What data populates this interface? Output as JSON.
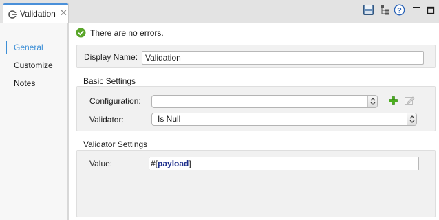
{
  "tab": {
    "label": "Validation",
    "close_glyph": "✕",
    "icon": "connector-icon"
  },
  "toolbar": {
    "icons": [
      "save-icon",
      "tree-icon",
      "help-icon",
      "minimize-icon",
      "maximize-icon"
    ]
  },
  "sidebar": {
    "items": [
      {
        "label": "General",
        "active": true
      },
      {
        "label": "Customize",
        "active": false
      },
      {
        "label": "Notes",
        "active": false
      }
    ]
  },
  "status": {
    "text": "There are no errors."
  },
  "general": {
    "display_name_label": "Display Name:",
    "display_name_value": "Validation"
  },
  "basic_settings": {
    "title": "Basic Settings",
    "configuration_label": "Configuration:",
    "configuration_value": "",
    "validator_label": "Validator:",
    "validator_value": "Is Null"
  },
  "validator_settings": {
    "title": "Validator Settings",
    "value_label": "Value:",
    "value_prefix": "#[",
    "value_keyword": "payload",
    "value_suffix": "]"
  },
  "colors": {
    "accent": "#3d8fd6",
    "success": "#5aa62a",
    "add": "#4caf1f"
  }
}
